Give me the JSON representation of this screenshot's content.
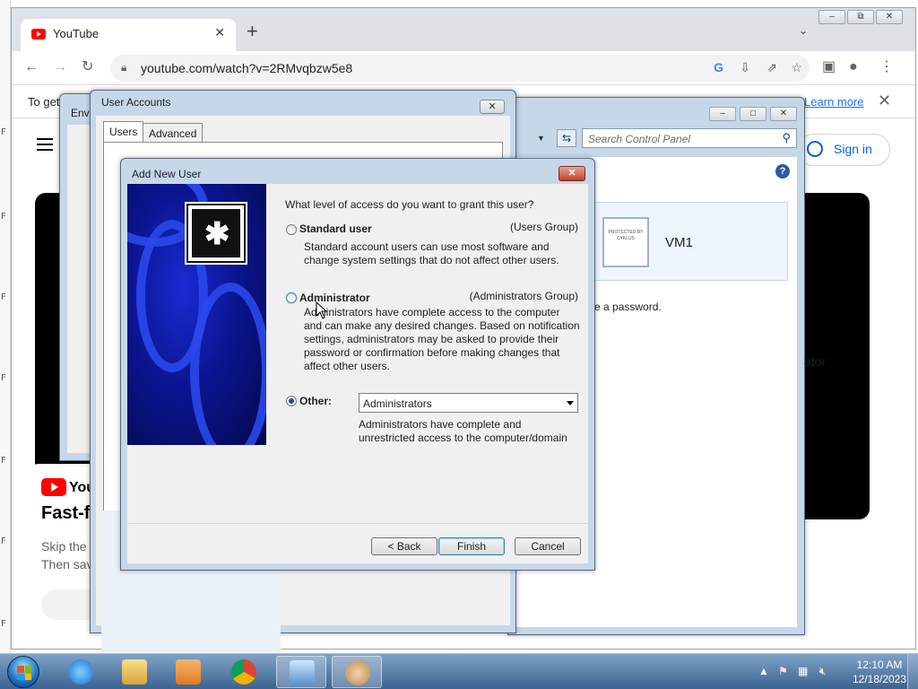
{
  "chrome": {
    "tab_title": "YouTube",
    "new_tab_glyph": "+",
    "url": "youtube.com/watch?v=2RMvqbzw5e8",
    "infobar_text": "To get",
    "infobar_link": "Learn more",
    "infobar_close": "✕",
    "window_min": "▭",
    "window_max": "⧉",
    "window_close": "✕"
  },
  "youtube": {
    "sign_in": "Sign in",
    "promo_logo_text": "You",
    "promo_title": "Fast-f",
    "promo_line1": "Skip the",
    "promo_line2": "Then sav",
    "player_bg": "#000000"
  },
  "env_window": {
    "title": "Env"
  },
  "control_panel": {
    "search_placeholder": "Search Control Panel",
    "help_glyph": "?",
    "account_name": "VM1",
    "account_pic_caption": "PROTECTED BY CYKLUS",
    "password_text": "e a password.",
    "role_text": "ator"
  },
  "user_accounts": {
    "title": "User Accounts",
    "close_glyph": "✕",
    "tabs": [
      "Users",
      "Advanced"
    ]
  },
  "add_new_user": {
    "title": "Add New User",
    "close_glyph": "✕",
    "prompt": "What level of access do you want to grant this user?",
    "options": [
      {
        "label": "Standard user",
        "group": "(Users Group)",
        "description_lines": [
          "Standard account users can use most software and",
          "change system settings that do not affect other users."
        ],
        "selected": false
      },
      {
        "label": "Administrator",
        "group": "(Administrators Group)",
        "description_lines": [
          "Administrators have complete access to the computer",
          "and can make any desired changes. Based on notification",
          "settings, administrators may be asked to provide their",
          "password or confirmation before making changes that",
          "affect other users."
        ],
        "selected": false
      },
      {
        "label": "Other:",
        "selected": true,
        "select_value": "Administrators",
        "description_lines": [
          "Administrators have complete and",
          "unrestricted access to the computer/domain"
        ]
      }
    ],
    "buttons": {
      "back": "< Back",
      "finish": "Finish",
      "cancel": "Cancel"
    }
  },
  "taskbar": {
    "time": "12:10 AM",
    "date": "12/18/2023",
    "accent": "#3b6390"
  }
}
